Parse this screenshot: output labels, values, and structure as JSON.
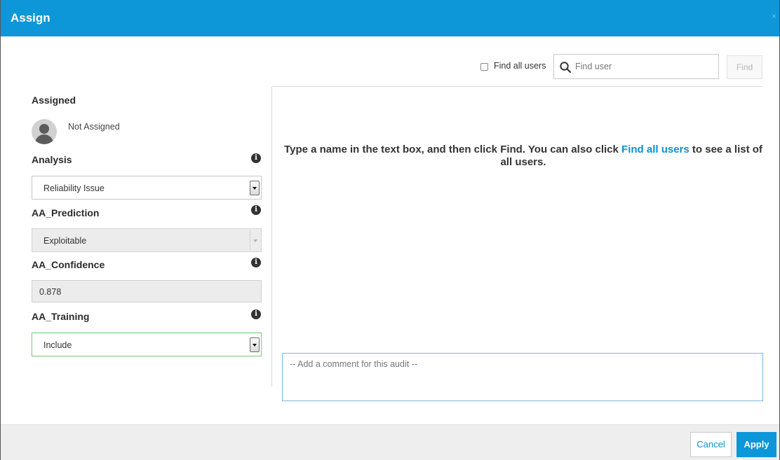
{
  "dialog": {
    "title": "Assign",
    "close_label": "×"
  },
  "search": {
    "find_all_label": "Find all users",
    "find_all_checked": false,
    "placeholder": "Find user",
    "value": "",
    "find_button_label": "Find"
  },
  "assigned": {
    "title": "Assigned",
    "user_name": "Not Assigned"
  },
  "fields": {
    "analysis": {
      "label": "Analysis",
      "value": "Reliability Issue"
    },
    "prediction": {
      "label": "AA_Prediction",
      "value": "Exploitable"
    },
    "confidence": {
      "label": "AA_Confidence",
      "value": "0.878"
    },
    "training": {
      "label": "AA_Training",
      "value": "Include"
    }
  },
  "hint": {
    "text_before": "Type a name in the text box, and then click Find. You can also click ",
    "link": "Find all users",
    "text_after": " to see a list of all users."
  },
  "comment": {
    "placeholder": "-- Add a comment for this audit --",
    "value": ""
  },
  "footer": {
    "cancel_label": "Cancel",
    "apply_label": "Apply"
  },
  "colors": {
    "accent": "#0d96d8",
    "link": "#0d8fd6"
  },
  "icons": {
    "search": "search-icon",
    "info": "info-icon",
    "avatar": "user-avatar-icon",
    "dropdown": "chevron-down-icon"
  }
}
